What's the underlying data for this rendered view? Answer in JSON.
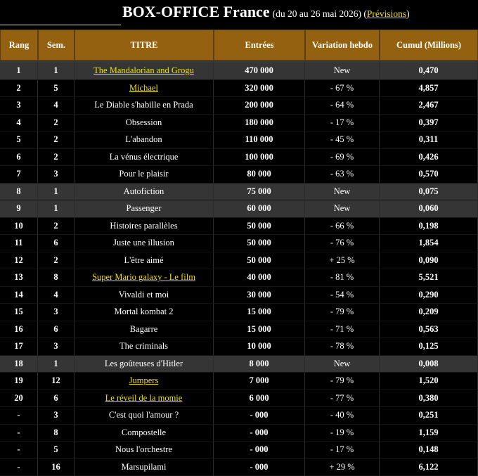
{
  "header": {
    "title": "BOX-OFFICE France",
    "subtitle_open": "(du 20 au 26 mai 2026) (",
    "link": "Prévisions",
    "subtitle_close": ")"
  },
  "columns": [
    "Rang",
    "Sem.",
    "TITRE",
    "Entrées",
    "Variation hebdo",
    "Cumul (Millions)"
  ],
  "rows": [
    {
      "rank": "1",
      "weeks": "1",
      "title": "The Mandalorian and Grogu",
      "entries": "470 000",
      "variation": "New",
      "cumul": "0,470",
      "link": true,
      "highlight": true
    },
    {
      "rank": "2",
      "weeks": "5",
      "title": "Michael",
      "entries": "320 000",
      "variation": "- 67 %",
      "cumul": "4,857",
      "link": true,
      "highlight": false
    },
    {
      "rank": "3",
      "weeks": "4",
      "title": "Le Diable s'habille en Prada",
      "entries": "200 000",
      "variation": "- 64 %",
      "cumul": "2,467",
      "link": false,
      "highlight": false
    },
    {
      "rank": "4",
      "weeks": "2",
      "title": "Obsession",
      "entries": "180 000",
      "variation": "- 17 %",
      "cumul": "0,397",
      "link": false,
      "highlight": false
    },
    {
      "rank": "5",
      "weeks": "2",
      "title": "L'abandon",
      "entries": "110 000",
      "variation": "- 45 %",
      "cumul": "0,311",
      "link": false,
      "highlight": false
    },
    {
      "rank": "6",
      "weeks": "2",
      "title": "La vénus électrique",
      "entries": "100 000",
      "variation": "- 69 %",
      "cumul": "0,426",
      "link": false,
      "highlight": false
    },
    {
      "rank": "7",
      "weeks": "3",
      "title": "Pour le plaisir",
      "entries": "80 000",
      "variation": "- 63 %",
      "cumul": "0,570",
      "link": false,
      "highlight": false
    },
    {
      "rank": "8",
      "weeks": "1",
      "title": "Autofiction",
      "entries": "75 000",
      "variation": "New",
      "cumul": "0,075",
      "link": false,
      "highlight": true
    },
    {
      "rank": "9",
      "weeks": "1",
      "title": "Passenger",
      "entries": "60 000",
      "variation": "New",
      "cumul": "0,060",
      "link": false,
      "highlight": true
    },
    {
      "rank": "10",
      "weeks": "2",
      "title": "Histoires parallèles",
      "entries": "50 000",
      "variation": "- 66 %",
      "cumul": "0,198",
      "link": false,
      "highlight": false
    },
    {
      "rank": "11",
      "weeks": "6",
      "title": "Juste une illusion",
      "entries": "50 000",
      "variation": "- 76 %",
      "cumul": "1,854",
      "link": false,
      "highlight": false
    },
    {
      "rank": "12",
      "weeks": "2",
      "title": "L'être aimé",
      "entries": "50 000",
      "variation": "+ 25 %",
      "cumul": "0,090",
      "link": false,
      "highlight": false
    },
    {
      "rank": "13",
      "weeks": "8",
      "title": "Super Mario galaxy - Le film",
      "entries": "40 000",
      "variation": "- 81 %",
      "cumul": "5,521",
      "link": true,
      "highlight": false
    },
    {
      "rank": "14",
      "weeks": "4",
      "title": "Vivaldi et moi",
      "entries": "30 000",
      "variation": "- 54 %",
      "cumul": "0,290",
      "link": false,
      "highlight": false
    },
    {
      "rank": "15",
      "weeks": "3",
      "title": "Mortal kombat 2",
      "entries": "15 000",
      "variation": "- 79 %",
      "cumul": "0,209",
      "link": false,
      "highlight": false
    },
    {
      "rank": "16",
      "weeks": "6",
      "title": "Bagarre",
      "entries": "15 000",
      "variation": "- 71 %",
      "cumul": "0,563",
      "link": false,
      "highlight": false
    },
    {
      "rank": "17",
      "weeks": "3",
      "title": "The criminals",
      "entries": "10 000",
      "variation": "- 78 %",
      "cumul": "0,125",
      "link": false,
      "highlight": false
    },
    {
      "rank": "18",
      "weeks": "1",
      "title": "Les goûteuses d'Hitler",
      "entries": "8 000",
      "variation": "New",
      "cumul": "0,008",
      "link": false,
      "highlight": true
    },
    {
      "rank": "19",
      "weeks": "12",
      "title": "Jumpers",
      "entries": "7 000",
      "variation": "- 79 %",
      "cumul": "1,520",
      "link": true,
      "highlight": false
    },
    {
      "rank": "20",
      "weeks": "6",
      "title": "Le réveil de la momie",
      "entries": "6 000",
      "variation": "- 77 %",
      "cumul": "0,380",
      "link": true,
      "highlight": false
    },
    {
      "rank": "-",
      "weeks": "3",
      "title": "C'est quoi l'amour ?",
      "entries": "- 000",
      "variation": "- 40 %",
      "cumul": "0,251",
      "link": false,
      "highlight": false
    },
    {
      "rank": "-",
      "weeks": "8",
      "title": "Compostelle",
      "entries": "- 000",
      "variation": "- 19 %",
      "cumul": "1,159",
      "link": false,
      "highlight": false
    },
    {
      "rank": "-",
      "weeks": "5",
      "title": "Nous l'orchestre",
      "entries": "- 000",
      "variation": "- 17 %",
      "cumul": "0,148",
      "link": false,
      "highlight": false
    },
    {
      "rank": "-",
      "weeks": "16",
      "title": "Marsupilami",
      "entries": "- 000",
      "variation": "+ 29 %",
      "cumul": "6,122",
      "link": false,
      "highlight": false
    }
  ],
  "colors": {
    "header_bg": "#936110",
    "highlight_bg": "#353535",
    "link": "#f0e000",
    "background": "#000000"
  }
}
